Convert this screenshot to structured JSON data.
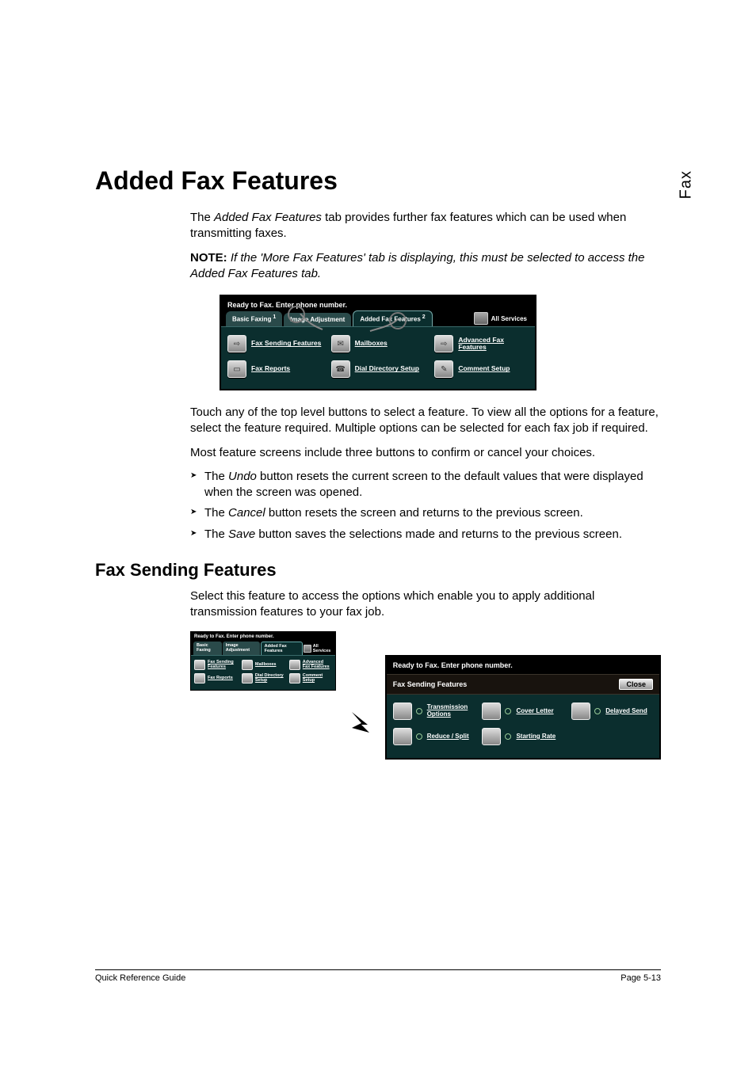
{
  "side_label": "Fax",
  "title": "Added Fax Features",
  "intro": {
    "p1_pre": "The ",
    "p1_em": "Added Fax Features",
    "p1_post": " tab provides further fax features which can be used when transmitting faxes."
  },
  "note": {
    "label": "NOTE:",
    "body": "If the 'More Fax Features' tab is displaying, this must be selected to access the Added Fax Features tab."
  },
  "main_ss": {
    "topbar": "Ready to Fax. Enter phone number.",
    "tabs": {
      "t1": "Basic Faxing",
      "t1_sup": "1",
      "t2": "Image Adjustment",
      "t3": "Added Fax Features",
      "t3_sup": "2",
      "all": "All Services"
    },
    "features": {
      "f1": "Fax Sending Features",
      "f2": "Mailboxes",
      "f3": "Advanced Fax Features",
      "f4": "Fax Reports",
      "f5": "Dial Directory Setup",
      "f6": "Comment Setup"
    }
  },
  "body2": {
    "p1": "Touch any of the top level buttons to select a feature. To view all the options for a feature, select the feature required. Multiple options can be selected for each fax job if required.",
    "p2": "Most feature screens include three buttons to confirm or cancel your choices."
  },
  "bullets": {
    "b1_pre": "The ",
    "b1_em": "Undo",
    "b1_post": " button resets the current screen to the default values that were displayed when the screen was opened.",
    "b2_pre": "The ",
    "b2_em": "Cancel",
    "b2_post": " button resets the screen and returns to the previous screen.",
    "b3_pre": "The ",
    "b3_em": "Save",
    "b3_post": " button saves the selections made and returns to the previous screen."
  },
  "section2": {
    "title": "Fax Sending Features",
    "p1": "Select this feature to access the options which enable you to apply additional transmission features to your fax job."
  },
  "mini_ss": {
    "topbar": "Ready to Fax. Enter phone number.",
    "tabs": {
      "t1": "Basic Faxing",
      "t2": "Image Adjustment",
      "t3": "Added Fax Features",
      "all": "All Services"
    },
    "features": {
      "f1": "Fax Sending Features",
      "f2": "Mailboxes",
      "f3": "Advanced Fax Features",
      "f4": "Fax Reports",
      "f5": "Dial Directory Setup",
      "f6": "Comment Setup"
    }
  },
  "detail_ss": {
    "topbar": "Ready to Fax. Enter phone number.",
    "header": "Fax Sending Features",
    "close": "Close",
    "features": {
      "f1": "Transmission Options",
      "f2": "Cover Letter",
      "f3": "Delayed Send",
      "f4": "Reduce / Split",
      "f5": "Starting Rate"
    }
  },
  "footer": {
    "left": "Quick Reference Guide",
    "right": "Page 5-13"
  }
}
